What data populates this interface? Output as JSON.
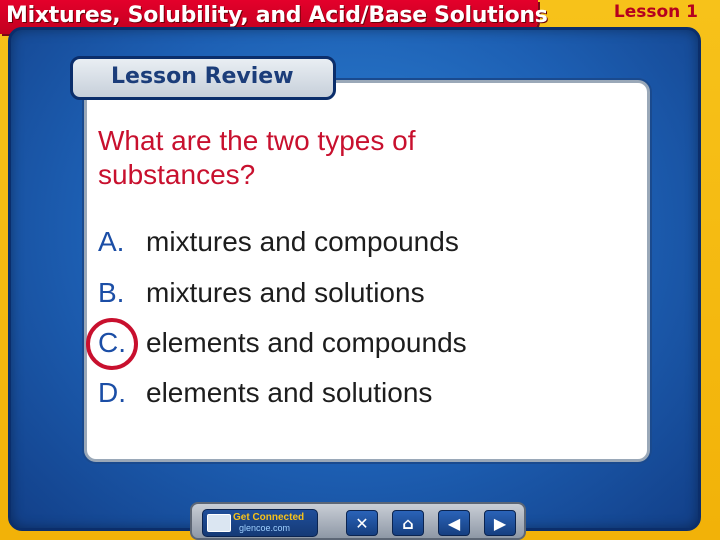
{
  "header": {
    "title": "Mixtures, Solubility, and Acid/Base Solutions",
    "lesson": "Lesson 1"
  },
  "panel": {
    "tab_label": "Lesson Review",
    "question": "What are the two types of substances?",
    "answers": [
      {
        "letter": "A.",
        "text": "mixtures and compounds"
      },
      {
        "letter": "B.",
        "text": "mixtures and solutions"
      },
      {
        "letter": "C.",
        "text": "elements and compounds",
        "circled": true
      },
      {
        "letter": "D.",
        "text": "elements and solutions"
      }
    ]
  },
  "nav": {
    "get_connected": "Get Connected",
    "get_connected_url": "glencoe.com",
    "close_glyph": "✕",
    "home_glyph": "⌂",
    "prev_glyph": "◀",
    "next_glyph": "▶"
  },
  "colors": {
    "title_red": "#e4002b",
    "frame_blue": "#1d5fb3",
    "question_red": "#c8102e",
    "letter_blue": "#1b4ea6",
    "background_gold": "#f7c21a"
  }
}
